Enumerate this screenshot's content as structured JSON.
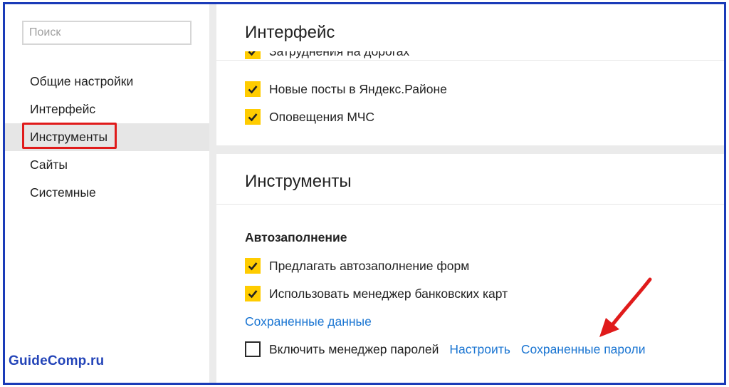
{
  "sidebar": {
    "search_placeholder": "Поиск",
    "items": [
      {
        "label": "Общие настройки"
      },
      {
        "label": "Интерфейс"
      },
      {
        "label": "Инструменты"
      },
      {
        "label": "Сайты"
      },
      {
        "label": "Системные"
      }
    ],
    "active_index": 2
  },
  "watermark": "GuideComp.ru",
  "interface_card": {
    "title": "Интерфейс",
    "partial_item": "Затруднения на дорогах",
    "items": [
      {
        "label": "Новые посты в Яндекс.Районе",
        "checked": true
      },
      {
        "label": "Оповещения МЧС",
        "checked": true
      }
    ]
  },
  "tools_card": {
    "title": "Инструменты",
    "section_title": "Автозаполнение",
    "items": [
      {
        "label": "Предлагать автозаполнение форм",
        "checked": true
      },
      {
        "label": "Использовать менеджер банковских карт",
        "checked": true
      }
    ],
    "saved_data_link": "Сохраненные данные",
    "password_manager": {
      "label": "Включить менеджер паролей",
      "checked": false,
      "configure_link": "Настроить",
      "saved_passwords_link": "Сохраненные пароли"
    }
  },
  "colors": {
    "accent_yellow": "#ffcc00",
    "link_blue": "#1a75d2",
    "highlight_red": "#e01b1b",
    "frame_blue": "#1a3bb8"
  }
}
